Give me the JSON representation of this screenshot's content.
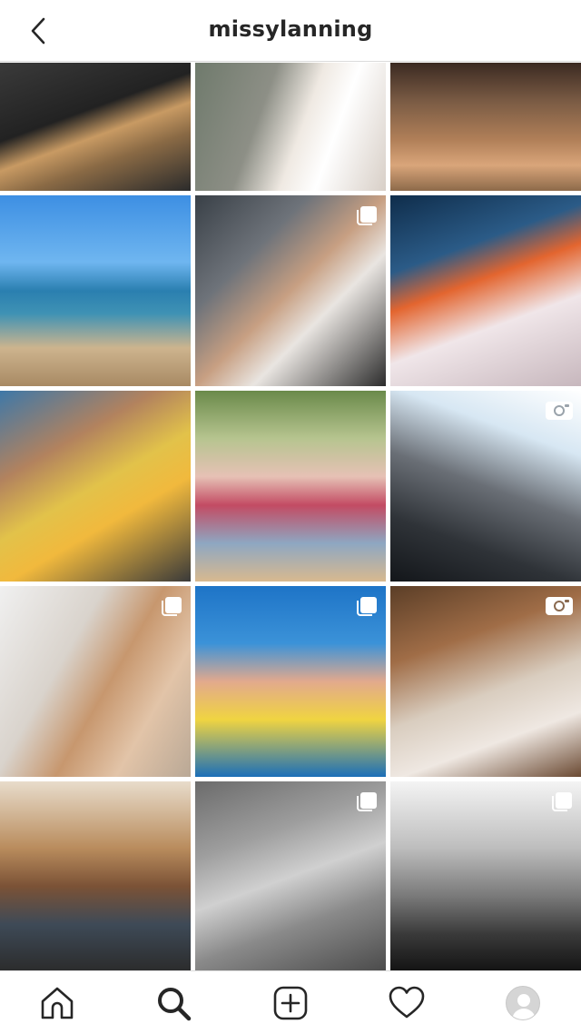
{
  "header": {
    "title": "missylanning",
    "back_icon": "chevron-left-icon"
  },
  "grid": {
    "tiles": [
      {
        "badge": null
      },
      {
        "badge": null
      },
      {
        "badge": null
      },
      {
        "badge": null
      },
      {
        "badge": "carousel-icon"
      },
      {
        "badge": null
      },
      {
        "badge": null
      },
      {
        "badge": null
      },
      {
        "badge": "video-icon"
      },
      {
        "badge": "carousel-icon"
      },
      {
        "badge": "carousel-icon"
      },
      {
        "badge": "video-icon"
      },
      {
        "badge": null
      },
      {
        "badge": "carousel-icon"
      },
      {
        "badge": "carousel-icon"
      }
    ]
  },
  "tabbar": {
    "items": [
      {
        "icon": "home-icon"
      },
      {
        "icon": "search-icon",
        "active": true
      },
      {
        "icon": "add-post-icon"
      },
      {
        "icon": "heart-icon"
      },
      {
        "icon": "profile-avatar"
      }
    ]
  },
  "colors": {
    "text": "#262626",
    "divider": "#dbdbdb",
    "background": "#ffffff"
  }
}
